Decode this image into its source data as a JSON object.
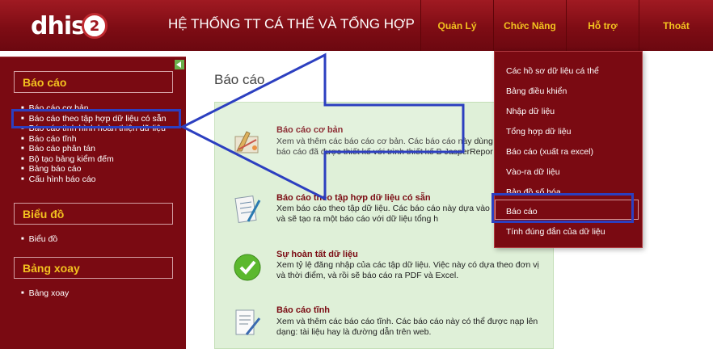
{
  "header": {
    "logo_text": "dhis",
    "logo_number": "2",
    "system_title": "HỆ THỐNG TT CÁ THỂ VÀ TỔNG HỢP",
    "nav": [
      "Quản Lý",
      "Chức Năng",
      "Hỗ trợ",
      "Thoát"
    ]
  },
  "sidebar": {
    "sections": [
      {
        "title": "Báo cáo",
        "items": [
          "Báo cáo cơ bản",
          "Báo cáo theo tập hợp dữ liệu có sẵn",
          "Báo cáo tình hình hoàn thiện dữ liệu",
          "Báo cáo tĩnh",
          "Báo cáo phân tán",
          "Bộ tạo bảng kiểm đếm",
          "Bảng báo cáo",
          "Cấu hình báo cáo"
        ]
      },
      {
        "title": "Biểu đồ",
        "items": [
          "Biểu đồ"
        ]
      },
      {
        "title": "Bảng xoay",
        "items": [
          "Bảng xoay"
        ]
      }
    ]
  },
  "content": {
    "title": "Báo cáo",
    "reports": [
      {
        "title": "Báo cáo cơ bản",
        "description": "Xem và thêm các báo cáo cơ bản. Các báo cáo này dùng là các bảng báo cáo đã được thiết kế với trình thiết kế B JasperRepor",
        "icon": "design-tools-icon"
      },
      {
        "title": "Báo cáo theo tập hợp dữ liệu có sẵn",
        "description": "Xem báo cáo theo tập dữ liệu. Các báo cáo này dựa vào nhập dữ liệu và sẽ tạo ra một báo cáo với dữ liệu tổng h",
        "icon": "form-pen-icon"
      },
      {
        "title": "Sự hoàn tất dữ liệu",
        "description": "Xem tỷ lệ đăng nhập của các tập dữ liệu. Việc này có dựa theo đơn vị và thời điểm, và rồi sẽ báo cáo ra PDF và Excel.",
        "icon": "check-icon"
      },
      {
        "title": "Báo cáo tĩnh",
        "description": "Xem và thêm các báo cáo tĩnh. Các báo cáo này có thể được nạp lên dạng: tài liệu hay là đường dẫn trên web.",
        "icon": "document-pen-icon"
      }
    ]
  },
  "dropdown": {
    "items": [
      "Các hồ sơ dữ liệu cá thể",
      "Bảng điều khiển",
      "Nhập dữ liệu",
      "Tổng hợp dữ liệu",
      "Báo cáo (xuất ra excel)",
      "Vào-ra dữ liệu",
      "Bản đồ số hóa",
      "Báo cáo",
      "Tính đúng đắn của dữ liệu"
    ],
    "selected": "Báo cáo"
  },
  "colors": {
    "brand_red": "#7a0a12",
    "nav_gold": "#f3c21f",
    "highlight_blue": "#2c3fc0",
    "panel_green": "#dff0d8"
  }
}
